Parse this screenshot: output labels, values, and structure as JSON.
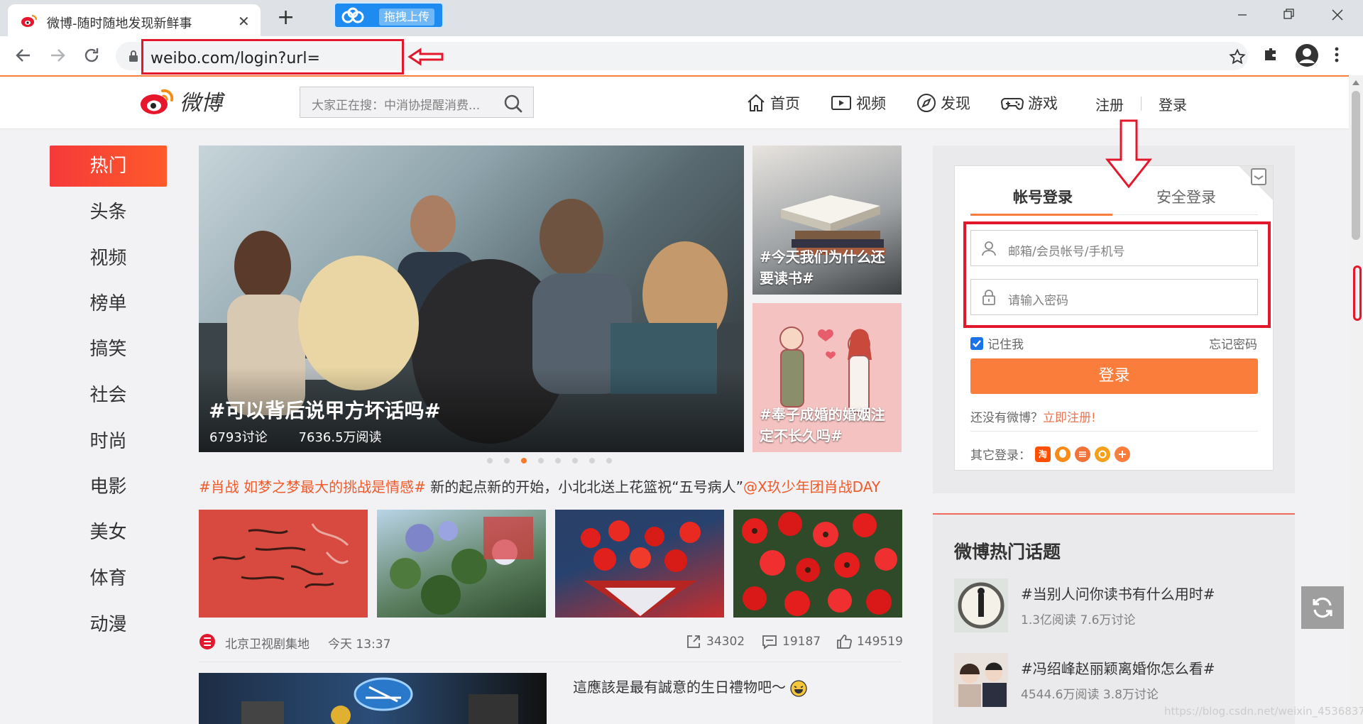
{
  "browser": {
    "tab_title": "微博-随时随地发现新鲜事",
    "upload_label": "拖拽上传",
    "url": "weibo.com/login?url="
  },
  "header": {
    "logo_text": "微博",
    "search_placeholder": "大家正在搜：中消协提醒消费...",
    "nav": [
      {
        "label": "首页",
        "icon": "home-icon"
      },
      {
        "label": "视频",
        "icon": "video-icon"
      },
      {
        "label": "发现",
        "icon": "compass-icon"
      },
      {
        "label": "游戏",
        "icon": "gamepad-icon"
      }
    ],
    "register": "注册",
    "login": "登录"
  },
  "sidebar": {
    "items": [
      {
        "label": "热门"
      },
      {
        "label": "头条"
      },
      {
        "label": "视频"
      },
      {
        "label": "榜单"
      },
      {
        "label": "搞笑"
      },
      {
        "label": "社会"
      },
      {
        "label": "时尚"
      },
      {
        "label": "电影"
      },
      {
        "label": "美女"
      },
      {
        "label": "体育"
      },
      {
        "label": "动漫"
      }
    ]
  },
  "feed": {
    "hero": {
      "title": "#可以背后说甲方坏话吗#",
      "discussions": "6793讨论",
      "reads": "7636.5万阅读"
    },
    "side_pics": [
      {
        "caption": "#今天我们为什么还要读书#"
      },
      {
        "caption": "#奉子成婚的婚姻注定不长久吗#"
      }
    ],
    "headline": {
      "tag": "#肖战 如梦之梦最大的挑战是情感#",
      "text": " 新的起点新的开始，小北北送上花篮祝“五号病人”",
      "mention": "@X玖少年团肖战DAY"
    },
    "post": {
      "source": "北京卫视剧集地",
      "time": "今天 13:37",
      "shares": "34302",
      "comments": "19187",
      "likes": "149519",
      "next_text": "這應該是最有誠意的生日禮物吧～"
    }
  },
  "login": {
    "tab_account": "帐号登录",
    "tab_secure": "安全登录",
    "username_placeholder": "邮箱/会员帐号/手机号",
    "password_placeholder": "请输入密码",
    "remember": "记住我",
    "forgot": "忘记密码",
    "submit": "登录",
    "no_account": "还没有微博？",
    "signup": "立即注册!",
    "other_login": "其它登录："
  },
  "hot_topics": {
    "title": "微博热门话题",
    "items": [
      {
        "name": "#当别人问你读书有什么用时#",
        "stat": "1.3亿阅读 7.6万讨论"
      },
      {
        "name": "#冯绍峰赵丽颖离婚你怎么看#",
        "stat": "4544.6万阅读 3.8万讨论"
      }
    ]
  },
  "watermark": "https://blog.csdn.net/weixin_4536837",
  "colors": {
    "accent": "#fa7d3c",
    "hot_red": "#f53a3a",
    "annotation_red": "#e3182d",
    "link": "#eb7350"
  }
}
